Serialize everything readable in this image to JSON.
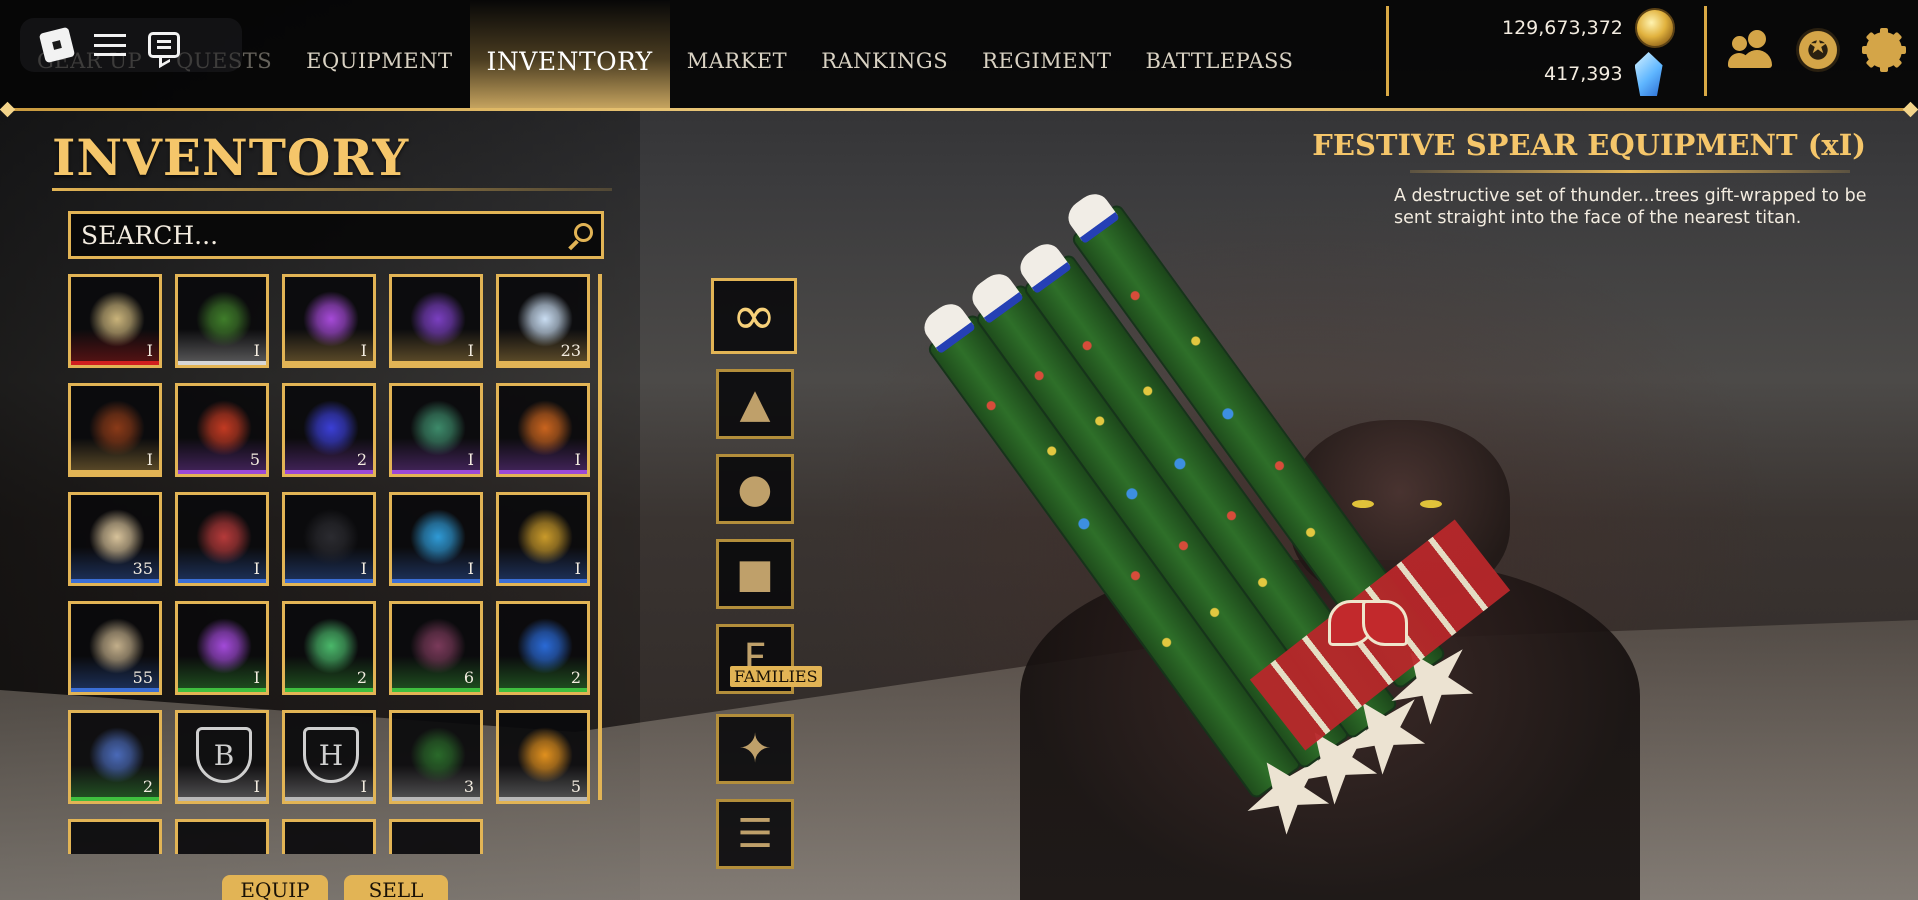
{
  "topbar": {
    "nav": [
      {
        "label": "GEAR UP",
        "name": "nav-gear-up",
        "faded": true
      },
      {
        "label": "QUESTS",
        "name": "nav-quests",
        "faded": true
      },
      {
        "label": "EQUIPMENT",
        "name": "nav-equipment"
      },
      {
        "label": "INVENTORY",
        "name": "nav-inventory",
        "active": true
      },
      {
        "label": "MARKET",
        "name": "nav-market"
      },
      {
        "label": "RANKINGS",
        "name": "nav-rankings"
      },
      {
        "label": "REGIMENT",
        "name": "nav-regiment"
      },
      {
        "label": "BATTLEPASS",
        "name": "nav-battlepass"
      }
    ],
    "gold_amount": "129,673,372",
    "gem_amount": "417,393",
    "icons": [
      "friends-icon",
      "star-badge-icon",
      "settings-gear-icon"
    ]
  },
  "inventory": {
    "title": "INVENTORY",
    "search_placeholder": "SEARCH...",
    "items": [
      {
        "count": "I",
        "rarity": "#d11f1f",
        "icon": "wreath-icon",
        "art": "#c9b37a"
      },
      {
        "count": "I",
        "rarity": "#d6d6d6",
        "icon": "spear-bundle-icon",
        "art": "#3f7d2a"
      },
      {
        "count": "I",
        "rarity": "#e2b455",
        "icon": "purple-orb-icon",
        "art": "#a64ad8"
      },
      {
        "count": "I",
        "rarity": "#e2b455",
        "icon": "purple-smoke-icon",
        "art": "#7a3fc0"
      },
      {
        "count": "23",
        "rarity": "#e2b455",
        "icon": "crystal-shard-icon",
        "art": "#c9ddf2"
      },
      {
        "count": "I",
        "rarity": "#e2b455",
        "icon": "small-figure-icon",
        "art": "#8a3a18"
      },
      {
        "count": "5",
        "rarity": "#9b4ad6",
        "icon": "red-key-icon",
        "art": "#c23a22"
      },
      {
        "count": "2",
        "rarity": "#9b4ad6",
        "icon": "blue-sparkle-icon",
        "art": "#3b3fd6"
      },
      {
        "count": "I",
        "rarity": "#9b4ad6",
        "icon": "green-sparkle-icon",
        "art": "#3d8a6a"
      },
      {
        "count": "I",
        "rarity": "#9b4ad6",
        "icon": "orange-device-icon",
        "art": "#c9641e"
      },
      {
        "count": "35",
        "rarity": "#3b6fd6",
        "icon": "scroll-icon",
        "art": "#d7c29a"
      },
      {
        "count": "I",
        "rarity": "#3b6fd6",
        "icon": "red-blue-sparkle-icon",
        "art": "#b53a3a"
      },
      {
        "count": "I",
        "rarity": "#3b6fd6",
        "icon": "dark-smoke-icon",
        "art": "#2b2b30"
      },
      {
        "count": "I",
        "rarity": "#3b6fd6",
        "icon": "cyan-sparkle-icon",
        "art": "#2f9ad6"
      },
      {
        "count": "I",
        "rarity": "#3b6fd6",
        "icon": "gold-sparkle-icon",
        "art": "#c99a2a"
      },
      {
        "count": "55",
        "rarity": "#3b6fd6",
        "icon": "blade-hilt-icon",
        "art": "#c2ae8a"
      },
      {
        "count": "I",
        "rarity": "#3fbf3f",
        "icon": "violet-orb-icon",
        "art": "#a24ad8"
      },
      {
        "count": "2",
        "rarity": "#3fbf3f",
        "icon": "green-pink-sparkle-icon",
        "art": "#4ab86a"
      },
      {
        "count": "6",
        "rarity": "#3fbf3f",
        "icon": "pink-dust-icon",
        "art": "#7a3a5a"
      },
      {
        "count": "2",
        "rarity": "#3fbf3f",
        "icon": "blue-smoke-icon",
        "art": "#2a6ad6"
      },
      {
        "count": "2",
        "rarity": "#3fbf3f",
        "icon": "blue-dots-icon",
        "art": "#4a6ab8"
      },
      {
        "count": "I",
        "rarity": "#b8b8b8",
        "icon": "b-crest-icon",
        "art": "#1a1a1a",
        "letter": "B"
      },
      {
        "count": "I",
        "rarity": "#b8b8b8",
        "icon": "h-crest-icon",
        "art": "#1a1a1a",
        "letter": "H"
      },
      {
        "count": "3",
        "rarity": "#b8b8b8",
        "icon": "green-dust-icon",
        "art": "#2a6a2a"
      },
      {
        "count": "5",
        "rarity": "#b8b8b8",
        "icon": "fire-burst-icon",
        "art": "#e0901e"
      },
      {
        "count": "",
        "rarity": "#e2b455",
        "icon": "partial-slot-icon",
        "art": "#111111"
      },
      {
        "count": "",
        "rarity": "#e2b455",
        "icon": "partial-slot-icon",
        "art": "#111111"
      },
      {
        "count": "",
        "rarity": "#e2b455",
        "icon": "partial-slot-icon",
        "art": "#111111"
      },
      {
        "count": "",
        "rarity": "#e2b455",
        "icon": "partial-slot-icon",
        "art": "#111111"
      }
    ],
    "equip_label": "EQUIP",
    "sell_label": "SELL"
  },
  "categories": [
    {
      "name": "all-infinity-icon",
      "glyph": "∞",
      "selected": true
    },
    {
      "name": "wizard-hat-icon",
      "glyph": "▲"
    },
    {
      "name": "potion-icon",
      "glyph": "●"
    },
    {
      "name": "chest-icon",
      "glyph": "■"
    },
    {
      "name": "families-crest-icon",
      "glyph": "F"
    },
    {
      "name": "ticket-icon",
      "glyph": "✦"
    },
    {
      "name": "list-icon",
      "glyph": "☰"
    }
  ],
  "families_label": "FAMILIES",
  "item_detail": {
    "title": "FESTIVE SPEAR EQUIPMENT (xI)",
    "description": "A destructive set of thunder...trees gift-wrapped to be sent straight into the face of the nearest titan."
  },
  "colors": {
    "accent": "#e2b455",
    "title": "#f5c66a"
  }
}
